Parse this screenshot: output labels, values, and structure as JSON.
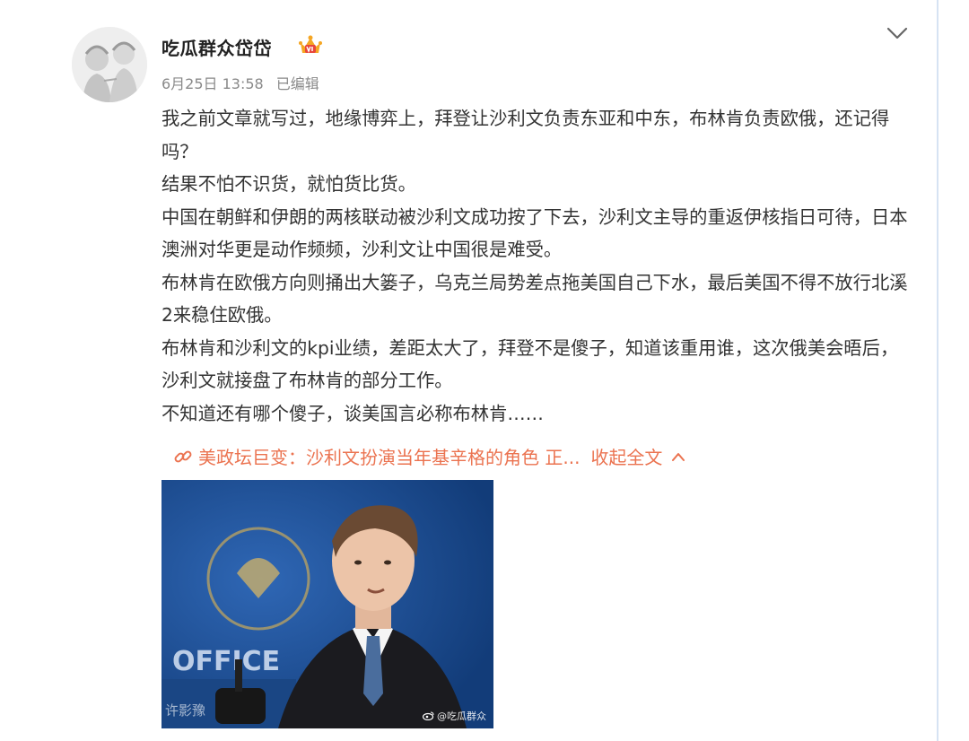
{
  "post": {
    "author": "吃瓜群众岱岱",
    "date": "6月25日 13:58",
    "edited": "已编辑",
    "paragraphs": [
      "我之前文章就写过，地缘博弈上，拜登让沙利文负责东亚和中东，布林肯负责欧俄，还记得吗？",
      "结果不怕不识货，就怕货比货。",
      "中国在朝鲜和伊朗的两核联动被沙利文成功按了下去，沙利文主导的重返伊核指日可待，日本澳洲对华更是动作频频，沙利文让中国很是难受。",
      "布林肯在欧俄方向则捅出大篓子，乌克兰局势差点拖美国自己下水，最后美国不得不放行北溪2来稳住欧俄。",
      "布林肯和沙利文的kpi业绩，差距太大了，拜登不是傻子，知道该重用谁，这次俄美会晤后，沙利文就接盘了布林肯的部分工作。",
      "不知道还有哪个傻子，谈美国言必称布林肯……"
    ],
    "link_text": "美政坛巨变：沙利文扮演当年基辛格的角色 正...",
    "collapse_label": "收起全文",
    "image": {
      "podium_text": "OFFICE",
      "watermark_left": "许影豫",
      "watermark_right": "@吃瓜群众"
    }
  },
  "colors": {
    "link": "#eb7350",
    "meta": "#8a8a8a",
    "text": "#333333"
  },
  "icons": [
    "avatar",
    "vip-crown-icon",
    "chevron-down-icon",
    "link-icon",
    "chevron-up-icon",
    "weibo-logo-icon"
  ]
}
